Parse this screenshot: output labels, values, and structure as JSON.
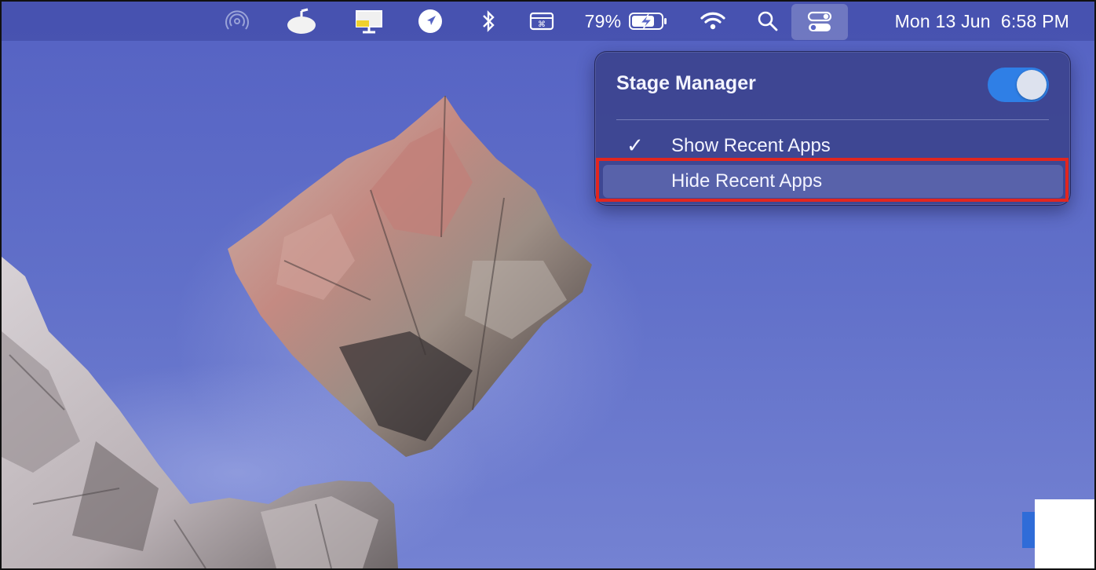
{
  "menubar": {
    "battery_percent": "79%",
    "datetime": "Mon 13 Jun  6:58 PM",
    "icons": [
      "airdrop-icon",
      "tamagotchi-icon",
      "screen-display-icon",
      "location-icon",
      "bluetooth-icon",
      "keyboard-icon",
      "battery-charging-icon",
      "wifi-icon",
      "search-icon",
      "control-center-icon"
    ]
  },
  "stage_manager": {
    "title": "Stage Manager",
    "enabled": true,
    "toggle_color": "#2f7fe6",
    "options": [
      {
        "label": "Show Recent Apps",
        "checked": true
      },
      {
        "label": "Hide Recent Apps",
        "checked": false
      }
    ]
  },
  "annotation": {
    "highlight_color": "#e2261f"
  }
}
